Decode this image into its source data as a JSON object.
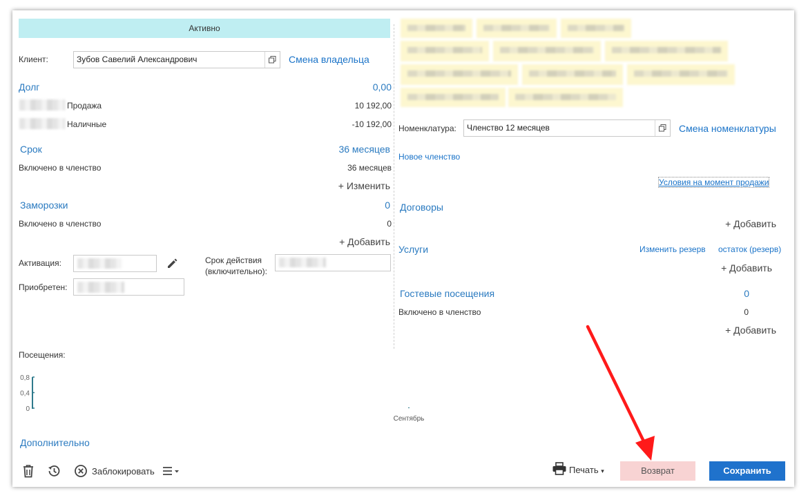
{
  "status": "Активно",
  "client": {
    "label": "Клиент:",
    "value": "Зубов Савелий Александрович",
    "change_owner_link": "Смена владельца"
  },
  "debt": {
    "title": "Долг",
    "total": "0,00",
    "rows": [
      {
        "label": "Продажа",
        "value": "10 192,00"
      },
      {
        "label": "Наличные",
        "value": "-10 192,00"
      }
    ]
  },
  "term": {
    "title": "Срок",
    "total": "36 месяцев",
    "row_label": "Включено в членство",
    "row_value": "36 месяцев",
    "change_label": "+ Изменить"
  },
  "freezes": {
    "title": "Заморозки",
    "total": "0",
    "row_label": "Включено в членство",
    "row_value": "0",
    "add_label": "+ Добавить"
  },
  "activation": {
    "label": "Активация:",
    "validity_label_1": "Срок действия",
    "validity_label_2": "(включительно):",
    "acquired_label": "Приобретен:"
  },
  "nomenclature": {
    "label": "Номенклатура:",
    "value": "Членство 12 месяцев",
    "change_link": "Смена номенклатуры"
  },
  "new_membership_link": "Новое членство",
  "conditions_link": "Условия на момент продажи",
  "contracts": {
    "title": "Договоры",
    "add_label": "+ Добавить"
  },
  "services": {
    "title": "Услуги",
    "change_reserve": "Изменить резерв",
    "balance_reserve": "остаток (резерв)",
    "add_label": "+ Добавить"
  },
  "guest_visits": {
    "title": "Гостевые посещения",
    "total": "0",
    "row_label": "Включено в членство",
    "row_value": "0",
    "add_label": "+ Добавить"
  },
  "visits": {
    "label": "Посещения:"
  },
  "chart_data": {
    "type": "bar",
    "categories": [
      "Сентябрь"
    ],
    "values": [
      0
    ],
    "y_ticks": [
      "0,8",
      "0,4",
      "0"
    ],
    "ylim": [
      0,
      0.8
    ]
  },
  "additional_link": "Дополнительно",
  "toolbar": {
    "block_label": "Заблокировать",
    "print_label": "Печать",
    "return_label": "Возврат",
    "save_label": "Сохранить"
  },
  "colors": {
    "status_bg": "#bfeef2",
    "link": "#1a73c8",
    "save_bg": "#1f72cc",
    "return_bg": "#f8d3d3",
    "arrow": "#ff1a1a"
  },
  "icons": {
    "open_form": "open-form-icon",
    "edit": "pencil-icon",
    "delete": "trash-icon",
    "history": "history-icon",
    "block": "block-icon",
    "menu": "menu-icon",
    "print": "printer-icon"
  }
}
